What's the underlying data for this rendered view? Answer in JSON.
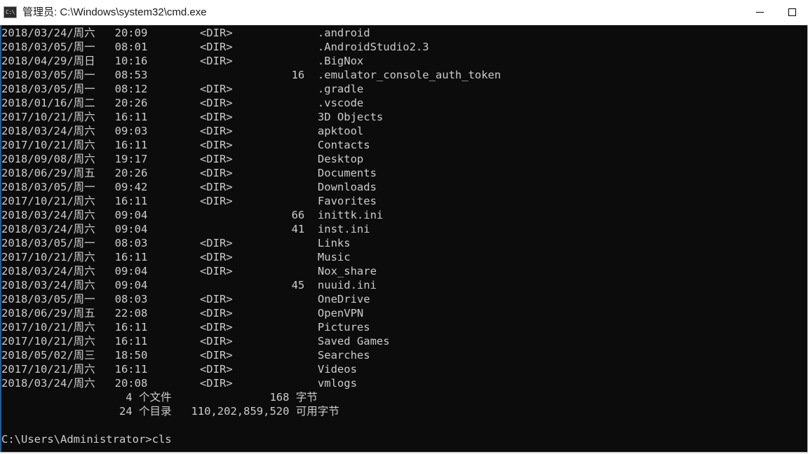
{
  "window": {
    "title": "管理员: C:\\Windows\\system32\\cmd.exe",
    "icon": "cmd-icon",
    "background_color": "#0c0c0c",
    "text_color": "#cccccc",
    "titlebar_color": "#ffffff",
    "controls": {
      "minimize_label": "—",
      "maximize_label": "□",
      "close_label": "✕"
    }
  },
  "console": {
    "columns": {
      "date_col": 0,
      "time_col": 18,
      "size_col": 31,
      "name_col": 49
    },
    "rows": [
      {
        "date": "2018/03/24/周六",
        "time": "20:09",
        "size": "<DIR>",
        "is_dir": true,
        "name": ".android"
      },
      {
        "date": "2018/03/05/周一",
        "time": "08:01",
        "size": "<DIR>",
        "is_dir": true,
        "name": ".AndroidStudio2.3"
      },
      {
        "date": "2018/04/29/周日",
        "time": "10:16",
        "size": "<DIR>",
        "is_dir": true,
        "name": ".BigNox"
      },
      {
        "date": "2018/03/05/周一",
        "time": "08:53",
        "size": "16",
        "is_dir": false,
        "name": ".emulator_console_auth_token"
      },
      {
        "date": "2018/03/05/周一",
        "time": "08:12",
        "size": "<DIR>",
        "is_dir": true,
        "name": ".gradle"
      },
      {
        "date": "2018/01/16/周二",
        "time": "20:26",
        "size": "<DIR>",
        "is_dir": true,
        "name": ".vscode"
      },
      {
        "date": "2017/10/21/周六",
        "time": "16:11",
        "size": "<DIR>",
        "is_dir": true,
        "name": "3D Objects"
      },
      {
        "date": "2018/03/24/周六",
        "time": "09:03",
        "size": "<DIR>",
        "is_dir": true,
        "name": "apktool"
      },
      {
        "date": "2017/10/21/周六",
        "time": "16:11",
        "size": "<DIR>",
        "is_dir": true,
        "name": "Contacts"
      },
      {
        "date": "2018/09/08/周六",
        "time": "19:17",
        "size": "<DIR>",
        "is_dir": true,
        "name": "Desktop"
      },
      {
        "date": "2018/06/29/周五",
        "time": "20:26",
        "size": "<DIR>",
        "is_dir": true,
        "name": "Documents"
      },
      {
        "date": "2018/03/05/周一",
        "time": "09:42",
        "size": "<DIR>",
        "is_dir": true,
        "name": "Downloads"
      },
      {
        "date": "2017/10/21/周六",
        "time": "16:11",
        "size": "<DIR>",
        "is_dir": true,
        "name": "Favorites"
      },
      {
        "date": "2018/03/24/周六",
        "time": "09:04",
        "size": "66",
        "is_dir": false,
        "name": "inittk.ini"
      },
      {
        "date": "2018/03/24/周六",
        "time": "09:04",
        "size": "41",
        "is_dir": false,
        "name": "inst.ini"
      },
      {
        "date": "2018/03/05/周一",
        "time": "08:03",
        "size": "<DIR>",
        "is_dir": true,
        "name": "Links"
      },
      {
        "date": "2017/10/21/周六",
        "time": "16:11",
        "size": "<DIR>",
        "is_dir": true,
        "name": "Music"
      },
      {
        "date": "2018/03/24/周六",
        "time": "09:04",
        "size": "<DIR>",
        "is_dir": true,
        "name": "Nox_share"
      },
      {
        "date": "2018/03/24/周六",
        "time": "09:04",
        "size": "45",
        "is_dir": false,
        "name": "nuuid.ini"
      },
      {
        "date": "2018/03/05/周一",
        "time": "08:03",
        "size": "<DIR>",
        "is_dir": true,
        "name": "OneDrive"
      },
      {
        "date": "2018/06/29/周五",
        "time": "22:08",
        "size": "<DIR>",
        "is_dir": true,
        "name": "OpenVPN"
      },
      {
        "date": "2017/10/21/周六",
        "time": "16:11",
        "size": "<DIR>",
        "is_dir": true,
        "name": "Pictures"
      },
      {
        "date": "2017/10/21/周六",
        "time": "16:11",
        "size": "<DIR>",
        "is_dir": true,
        "name": "Saved Games"
      },
      {
        "date": "2018/05/02/周三",
        "time": "18:50",
        "size": "<DIR>",
        "is_dir": true,
        "name": "Searches"
      },
      {
        "date": "2017/10/21/周六",
        "time": "16:11",
        "size": "<DIR>",
        "is_dir": true,
        "name": "Videos"
      },
      {
        "date": "2018/03/24/周六",
        "time": "20:08",
        "size": "<DIR>",
        "is_dir": true,
        "name": "vmlogs"
      }
    ],
    "summary": {
      "file_count": "4",
      "file_count_label": "个文件",
      "total_bytes": "168",
      "bytes_label": "字节",
      "dir_count": "24",
      "dir_count_label": "个目录",
      "free_bytes": "110,202,859,520",
      "free_bytes_label": "可用字节"
    },
    "prompt": {
      "path": "C:\\Users\\Administrator>",
      "command": "cls"
    }
  }
}
